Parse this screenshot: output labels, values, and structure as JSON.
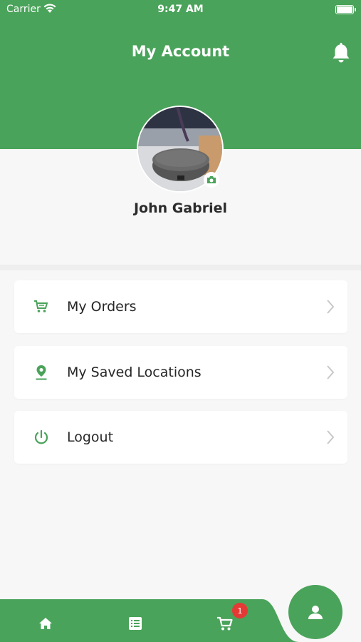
{
  "status_bar": {
    "carrier": "Carrier",
    "time": "9:47 AM"
  },
  "header": {
    "title": "My Account",
    "bell_icon": "bell-icon"
  },
  "profile": {
    "name": "John Gabriel",
    "camera_icon": "camera-icon"
  },
  "menu": {
    "items": [
      {
        "label": "My Orders",
        "icon": "cart-icon"
      },
      {
        "label": "My Saved Locations",
        "icon": "location-pin-icon"
      },
      {
        "label": "Logout",
        "icon": "power-icon"
      }
    ]
  },
  "tabbar": {
    "items": [
      {
        "icon": "home-icon"
      },
      {
        "icon": "list-icon"
      },
      {
        "icon": "cart-icon",
        "badge": "1"
      },
      {
        "icon": "user-icon"
      }
    ]
  },
  "colors": {
    "brand_green": "#4aa35a",
    "badge_red": "#e53935",
    "background": "#f7f7f7"
  }
}
